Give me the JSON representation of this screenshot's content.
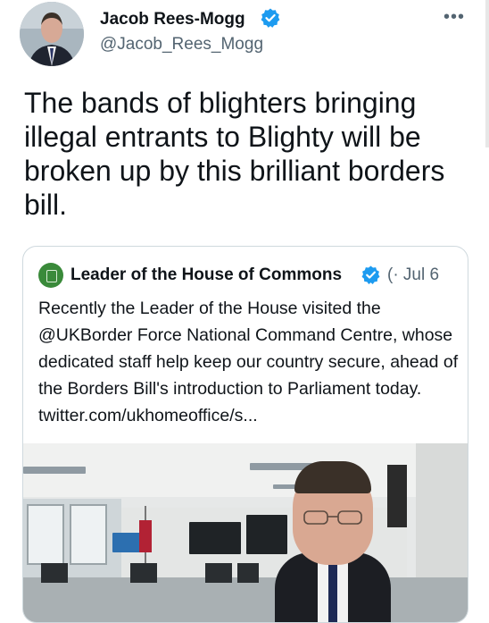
{
  "author": {
    "display_name": "Jacob Rees-Mogg",
    "handle": "@Jacob_Rees_Mogg",
    "verified": true,
    "more_icon": "more-dots-icon"
  },
  "tweet": {
    "text": "The bands of blighters bringing illegal entrants to Blighty will be broken up by this brilliant borders bill."
  },
  "quoted": {
    "name": "Leader of the House of Commons",
    "verified": true,
    "meta": "(· Jul 6",
    "text": "Recently the Leader of the House visited the @UKBorder Force National Command Centre, whose dedicated staff help keep our country secure, ahead of the Borders Bill's introduction to Parliament today.  twitter.com/ukhomeoffice/s..."
  },
  "colors": {
    "verified_blue": "#1d9bf0",
    "secondary_text": "#536471",
    "card_border": "#cfd9de"
  }
}
